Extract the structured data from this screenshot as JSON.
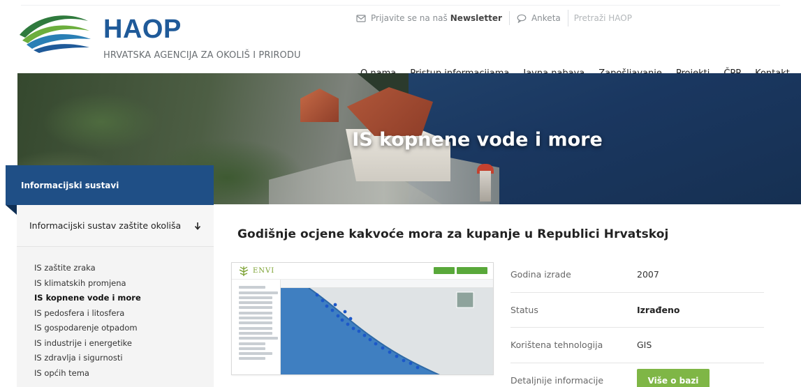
{
  "brand": {
    "title": "HAOP",
    "subtitle": "HRVATSKA AGENCIJA ZA OKOLIŠ I PRIRODU",
    "primary_color": "#1f5a99",
    "accent_green": "#7fb646"
  },
  "utility": {
    "newsletter_prefix": "Prijavite se na naš",
    "newsletter_strong": "Newsletter",
    "newsletter_icon": "envelope-icon",
    "survey_label": "Anketa",
    "survey_icon": "speech-bubble-icon",
    "search_placeholder": "Pretraži HAOP"
  },
  "nav": {
    "items": [
      {
        "label": "O nama"
      },
      {
        "label": "Pristup informacijama"
      },
      {
        "label": "Javna nabava"
      },
      {
        "label": "Zapošljavanje"
      },
      {
        "label": "Projekti"
      },
      {
        "label": "ČPP"
      },
      {
        "label": "Kontakt"
      }
    ]
  },
  "hero": {
    "title": "IS kopnene vode i more"
  },
  "sidebar": {
    "tab_label": "Informacijski sustavi",
    "section_label": "Informacijski sustav zaštite okoliša",
    "section_icon": "arrow-down-icon",
    "items": [
      {
        "label": "IS zaštite zraka",
        "active": false
      },
      {
        "label": "IS klimatskih promjena",
        "active": false
      },
      {
        "label": "IS kopnene vode i more",
        "active": true
      },
      {
        "label": "IS pedosfera i litosfera",
        "active": false
      },
      {
        "label": "IS gospodarenje otpadom",
        "active": false
      },
      {
        "label": "IS industrije i energetike",
        "active": false
      },
      {
        "label": "IS zdravlja i sigurnosti",
        "active": false
      },
      {
        "label": "IS općih tema",
        "active": false
      }
    ]
  },
  "content": {
    "title": "Godišnje ocjene kakvoće mora za kupanje u Republici Hrvatskoj",
    "thumbnail_brand": "ENVI",
    "details": [
      {
        "label": "Godina izrade",
        "value": "2007"
      },
      {
        "label": "Status",
        "value": "Izrađeno"
      },
      {
        "label": "Korištena tehnologija",
        "value": "GIS"
      },
      {
        "label": "Detaljnije informacije",
        "button": "Više o bazi"
      }
    ]
  }
}
